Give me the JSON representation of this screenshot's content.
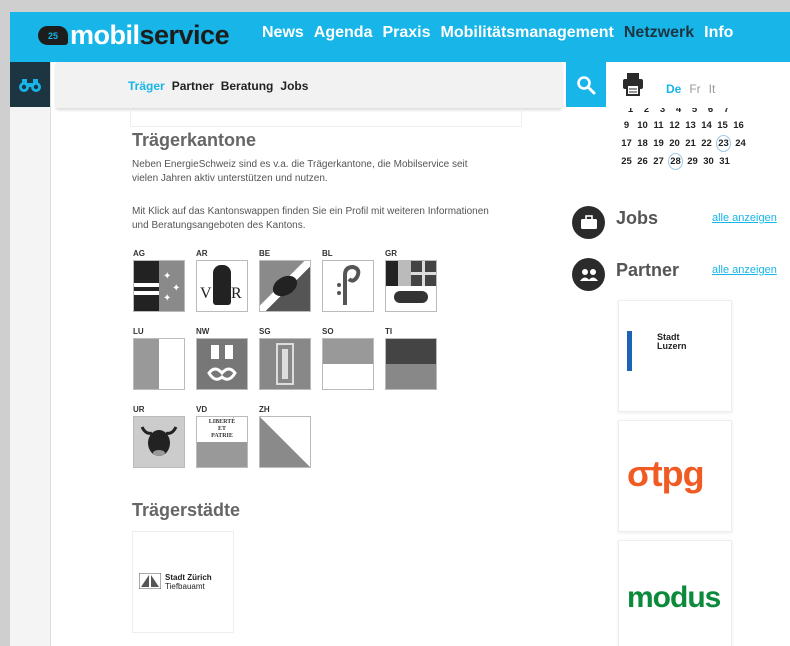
{
  "brand": {
    "badge": "25",
    "name_part1": "mobil",
    "name_part2": "service"
  },
  "main_nav": [
    {
      "label": "News"
    },
    {
      "label": "Agenda"
    },
    {
      "label": "Praxis"
    },
    {
      "label": "Mobilitätsmanagement"
    },
    {
      "label": "Netzwerk"
    },
    {
      "label": "Info"
    }
  ],
  "sub_nav": [
    {
      "label": "Träger",
      "active": true
    },
    {
      "label": "Partner"
    },
    {
      "label": "Beratung"
    },
    {
      "label": "Jobs"
    }
  ],
  "languages": [
    "De",
    "Fr",
    "It"
  ],
  "calendar": {
    "rows": [
      [
        "1",
        "2",
        "3",
        "4",
        "5",
        "6",
        "7"
      ],
      [
        "9",
        "10",
        "11",
        "12",
        "13",
        "14",
        "15",
        "16"
      ],
      [
        "17",
        "18",
        "19",
        "20",
        "21",
        "22",
        "23",
        "24"
      ],
      [
        "25",
        "26",
        "27",
        "28",
        "29",
        "30",
        "31"
      ]
    ],
    "circled": [
      "23",
      "28"
    ]
  },
  "jobs": {
    "title": "Jobs",
    "link": "alle anzeigen"
  },
  "partner": {
    "title": "Partner",
    "link": "alle anzeigen",
    "logos": [
      {
        "line1": "Stadt",
        "line2": "Luzern"
      },
      {
        "text": "tpg"
      },
      {
        "text": "modus"
      }
    ]
  },
  "content": {
    "heading": "Trägerkantone",
    "para1": "Neben EnergieSchweiz sind es v.a. die Trägerkantone, die Mobil­service seit vielen Jahren aktiv unterstützen und nutzen.",
    "para2": "Mit Klick auf das Kantonswappen finden Sie ein Profil mit weiteren Informationen und Beratungsangeboten des Kantons.",
    "cantons": [
      "AG",
      "AR",
      "BE",
      "BL",
      "GR",
      "LU",
      "NW",
      "SG",
      "SO",
      "TI",
      "UR",
      "VD",
      "ZH"
    ],
    "vd_motto": [
      "LIBERTÉ",
      "ET",
      "PATRIE"
    ],
    "ar_letters": [
      "V",
      "R"
    ],
    "heading2": "Trägerstädte",
    "city_logo": {
      "line1": "Stadt Zürich",
      "line2": "Tiefbauamt"
    }
  }
}
